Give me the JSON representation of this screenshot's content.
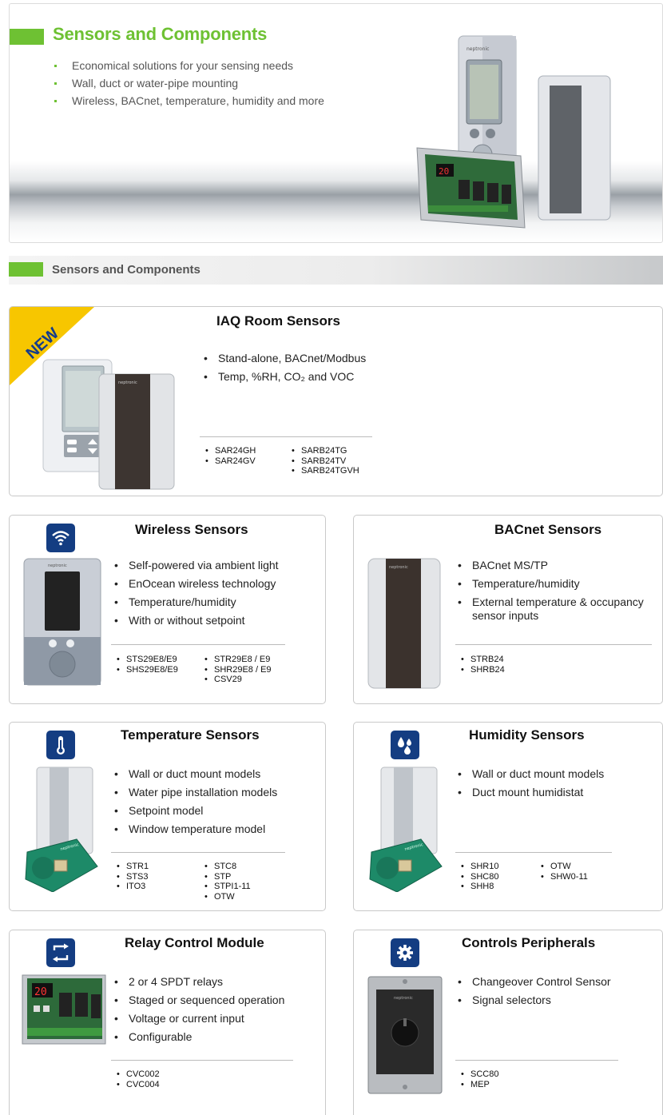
{
  "hero": {
    "title": "Sensors and Components",
    "bullets": [
      "Economical solutions for your sensing needs",
      "Wall, duct or water-pipe mounting",
      "Wireless, BACnet, temperature, humidity and more"
    ]
  },
  "section": {
    "title": "Sensors and Components"
  },
  "iaq": {
    "badge": "NEW",
    "title": "IAQ Room Sensors",
    "features": [
      "Stand-alone, BACnet/Modbus",
      "Temp, %RH, CO₂ and VOC"
    ],
    "models_left": [
      "SAR24GH",
      "SAR24GV"
    ],
    "models_right": [
      "SARB24TG",
      "SARB24TV",
      "SARB24TGVH"
    ]
  },
  "wireless": {
    "title": "Wireless Sensors",
    "icon": "wifi-icon",
    "features": [
      "Self-powered via ambient light",
      "EnOcean wireless technology",
      "Temperature/humidity",
      "With or without setpoint"
    ],
    "models_left": [
      "STS29E8/E9",
      "SHS29E8/E9"
    ],
    "models_right": [
      "STR29E8 / E9",
      "SHR29E8 / E9",
      "CSV29"
    ]
  },
  "bacnet": {
    "title": "BACnet Sensors",
    "features": [
      "BACnet MS/TP",
      "Temperature/humidity",
      "External temperature & occupancy sensor inputs"
    ],
    "models_left": [
      "STRB24",
      "SHRB24"
    ],
    "models_right": []
  },
  "temperature": {
    "title": "Temperature Sensors",
    "icon": "thermometer-icon",
    "features": [
      "Wall or duct mount models",
      "Water pipe installation models",
      "Setpoint model",
      "Window temperature model"
    ],
    "models_left": [
      "STR1",
      "STS3",
      "ITO3"
    ],
    "models_right": [
      "STC8",
      "STP",
      "STPI1-11",
      "OTW"
    ]
  },
  "humidity": {
    "title": "Humidity Sensors",
    "icon": "humidity-drops-icon",
    "features": [
      "Wall or duct mount models",
      "Duct mount humidistat"
    ],
    "models_left": [
      "SHR10",
      "SHC80",
      "SHH8"
    ],
    "models_right": [
      "OTW",
      "SHW0-11"
    ]
  },
  "relay": {
    "title": "Relay Control Module",
    "icon": "relay-cycle-icon",
    "features": [
      "2 or 4 SPDT relays",
      "Staged or sequenced operation",
      "Voltage or current input",
      "Configurable"
    ],
    "models_left": [
      "CVC002",
      "CVC004"
    ],
    "models_right": []
  },
  "peripherals": {
    "title": "Controls Peripherals",
    "icon": "gear-icon",
    "features": [
      "Changeover Control Sensor",
      "Signal selectors"
    ],
    "models_left": [
      "SCC80",
      "MEP"
    ],
    "models_right": []
  },
  "brand_text": "neptronic",
  "colors": {
    "accent_green": "#6ec133",
    "icon_blue": "#143d82",
    "ribbon_yellow": "#f7c600"
  }
}
